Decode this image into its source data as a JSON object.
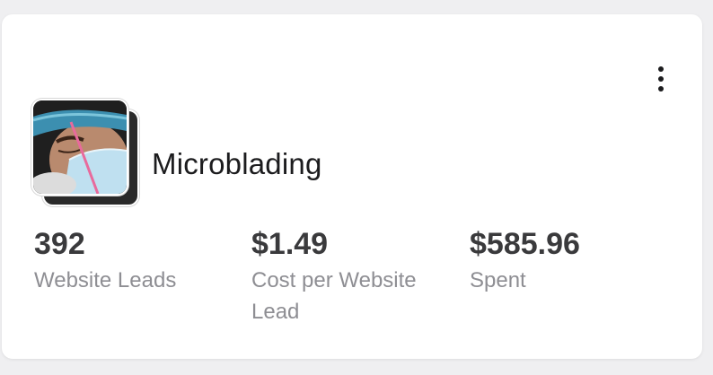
{
  "card": {
    "campaign_name": "Microblading",
    "thumbnail_icon": "campaign-photo",
    "menu_icon": "more-vertical-icon",
    "metrics": [
      {
        "value": "392",
        "label": "Website Leads"
      },
      {
        "value": "$1.49",
        "label_line1": "Cost per Website",
        "label_line2": "Lead"
      },
      {
        "value": "$585.96",
        "label": "Spent"
      }
    ]
  },
  "colors": {
    "background": "#efeff1",
    "card": "#ffffff",
    "title_text": "#1c1c1e",
    "value_text": "#3a3a3c",
    "label_text": "#8e8e93"
  }
}
